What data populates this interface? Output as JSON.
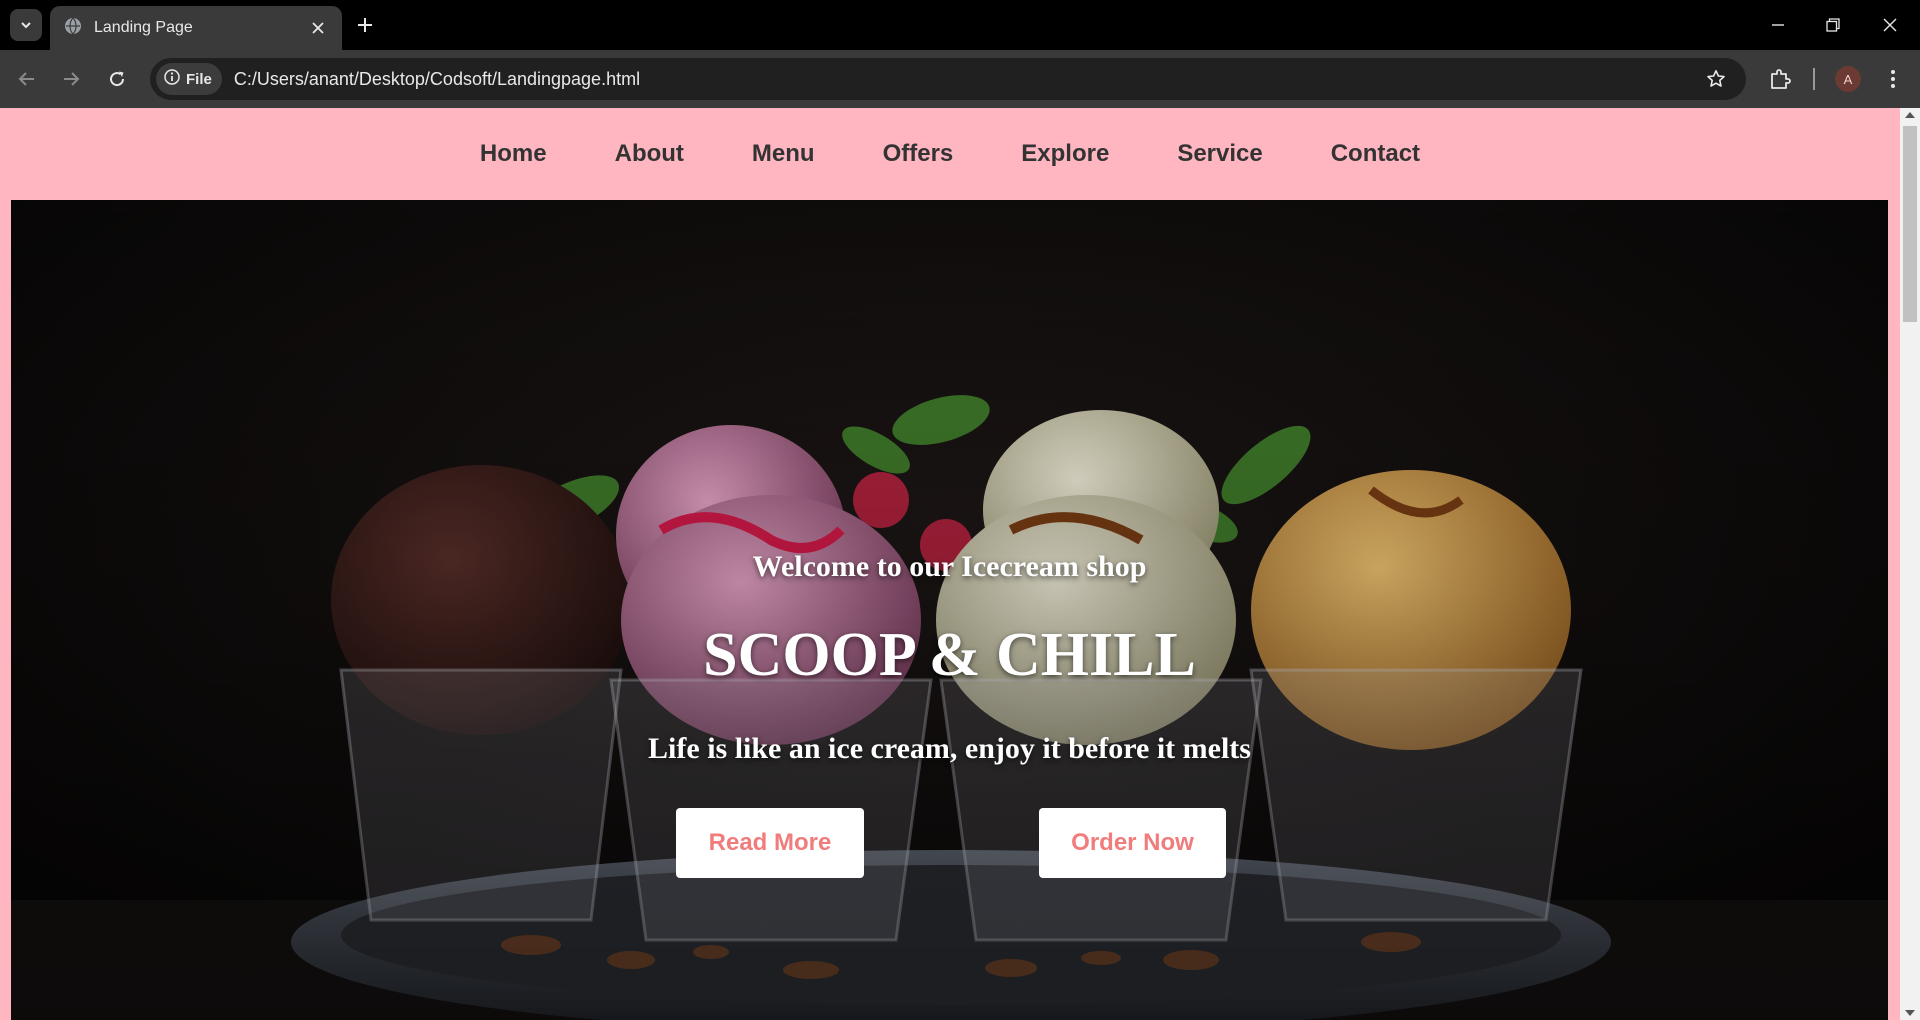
{
  "browser": {
    "tab_title": "Landing Page",
    "file_chip_label": "File",
    "url": "C:/Users/anant/Desktop/Codsoft/Landingpage.html",
    "profile_initial": "A",
    "icons": [
      "tab-search-icon",
      "globe-icon",
      "close-icon",
      "plus-icon",
      "minimize-icon",
      "restore-icon",
      "window-close-icon",
      "back-icon",
      "forward-icon",
      "reload-icon",
      "info-icon",
      "star-icon",
      "extensions-icon",
      "more-icon"
    ]
  },
  "nav": {
    "items": [
      "Home",
      "About",
      "Menu",
      "Offers",
      "Explore",
      "Service",
      "Contact"
    ]
  },
  "hero": {
    "welcome": "Welcome to our Icecream shop",
    "title": "SCOOP & CHILL",
    "tagline": "Life is like an ice cream, enjoy it before it melts",
    "read_more": "Read More",
    "order_now": "Order Now"
  },
  "colors": {
    "nav_background": "#ffb6c1",
    "nav_text": "#333333",
    "button_text": "#f07c7c",
    "button_background": "#ffffff",
    "hero_text": "#ffffff"
  }
}
